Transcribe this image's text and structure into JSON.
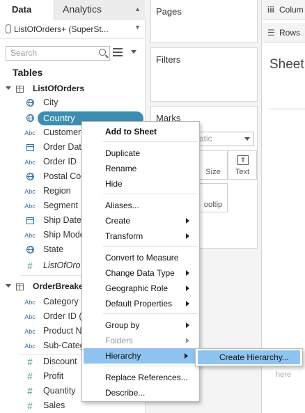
{
  "tabs": {
    "data": "Data",
    "analytics": "Analytics"
  },
  "datasource": "ListOfOrders+ (SuperSt...",
  "search": {
    "placeholder": "Search"
  },
  "tables_title": "Tables",
  "groups": [
    {
      "name": "ListOfOrders",
      "fields": [
        {
          "label": "City",
          "icon": "globe-icon"
        },
        {
          "label": "Country",
          "icon": "globe-icon",
          "selected": true
        },
        {
          "label": "Customer",
          "icon": "abc-icon",
          "icon_text": "Abc"
        },
        {
          "label": "Order Dat",
          "icon": "calendar-icon"
        },
        {
          "label": "Order ID",
          "icon": "abc-icon",
          "icon_text": "Abc"
        },
        {
          "label": "Postal Coo",
          "icon": "globe-icon"
        },
        {
          "label": "Region",
          "icon": "abc-icon",
          "icon_text": "Abc"
        },
        {
          "label": "Segment",
          "icon": "abc-icon",
          "icon_text": "Abc"
        },
        {
          "label": "Ship Date",
          "icon": "calendar-icon"
        },
        {
          "label": "Ship Mode",
          "icon": "abc-icon",
          "icon_text": "Abc"
        },
        {
          "label": "State",
          "icon": "globe-icon"
        },
        {
          "label": "ListOfOro",
          "icon": "hash-icon",
          "icon_text": "#"
        }
      ]
    },
    {
      "name": "OrderBreake",
      "fields": [
        {
          "label": "Category",
          "icon": "abc-icon",
          "icon_text": "Abc"
        },
        {
          "label": "Order ID (",
          "icon": "abc-icon",
          "icon_text": "Abc"
        },
        {
          "label": "Product N",
          "icon": "abc-icon",
          "icon_text": "Abc"
        },
        {
          "label": "Sub-Categ",
          "icon": "abc-icon",
          "icon_text": "Abc"
        },
        {
          "label": "Discount",
          "icon": "hash-icon",
          "icon_text": "#"
        },
        {
          "label": "Profit",
          "icon": "hash-icon",
          "icon_text": "#"
        },
        {
          "label": "Quantity",
          "icon": "hash-icon",
          "icon_text": "#"
        },
        {
          "label": "Sales",
          "icon": "hash-icon",
          "icon_text": "#"
        }
      ]
    }
  ],
  "shelves": {
    "pages": "Pages",
    "filters": "Filters",
    "marks": "Marks",
    "marks_type": "atic",
    "size": "Size",
    "text": "Text",
    "text_icon": "T",
    "tooltip": "ooltip",
    "columns": "Colum",
    "rows": "Rows"
  },
  "sheet": {
    "title": "Sheet",
    "drop_hint": "here"
  },
  "context_menu": {
    "items": [
      {
        "label": "Add to Sheet",
        "bold": true
      },
      {
        "label": "Duplicate"
      },
      {
        "label": "Rename"
      },
      {
        "label": "Hide"
      },
      {
        "label": "Aliases..."
      },
      {
        "label": "Create",
        "submenu": true
      },
      {
        "label": "Transform",
        "submenu": true
      },
      {
        "label": "Convert to Measure"
      },
      {
        "label": "Change Data Type",
        "submenu": true
      },
      {
        "label": "Geographic Role",
        "submenu": true
      },
      {
        "label": "Default Properties",
        "submenu": true
      },
      {
        "label": "Group by",
        "submenu": true
      },
      {
        "label": "Folders",
        "submenu": true,
        "disabled": true
      },
      {
        "label": "Hierarchy",
        "submenu": true,
        "active": true
      },
      {
        "label": "Replace References..."
      },
      {
        "label": "Describe..."
      }
    ]
  },
  "hierarchy_submenu": {
    "create_hierarchy": "Create Hierarchy..."
  }
}
